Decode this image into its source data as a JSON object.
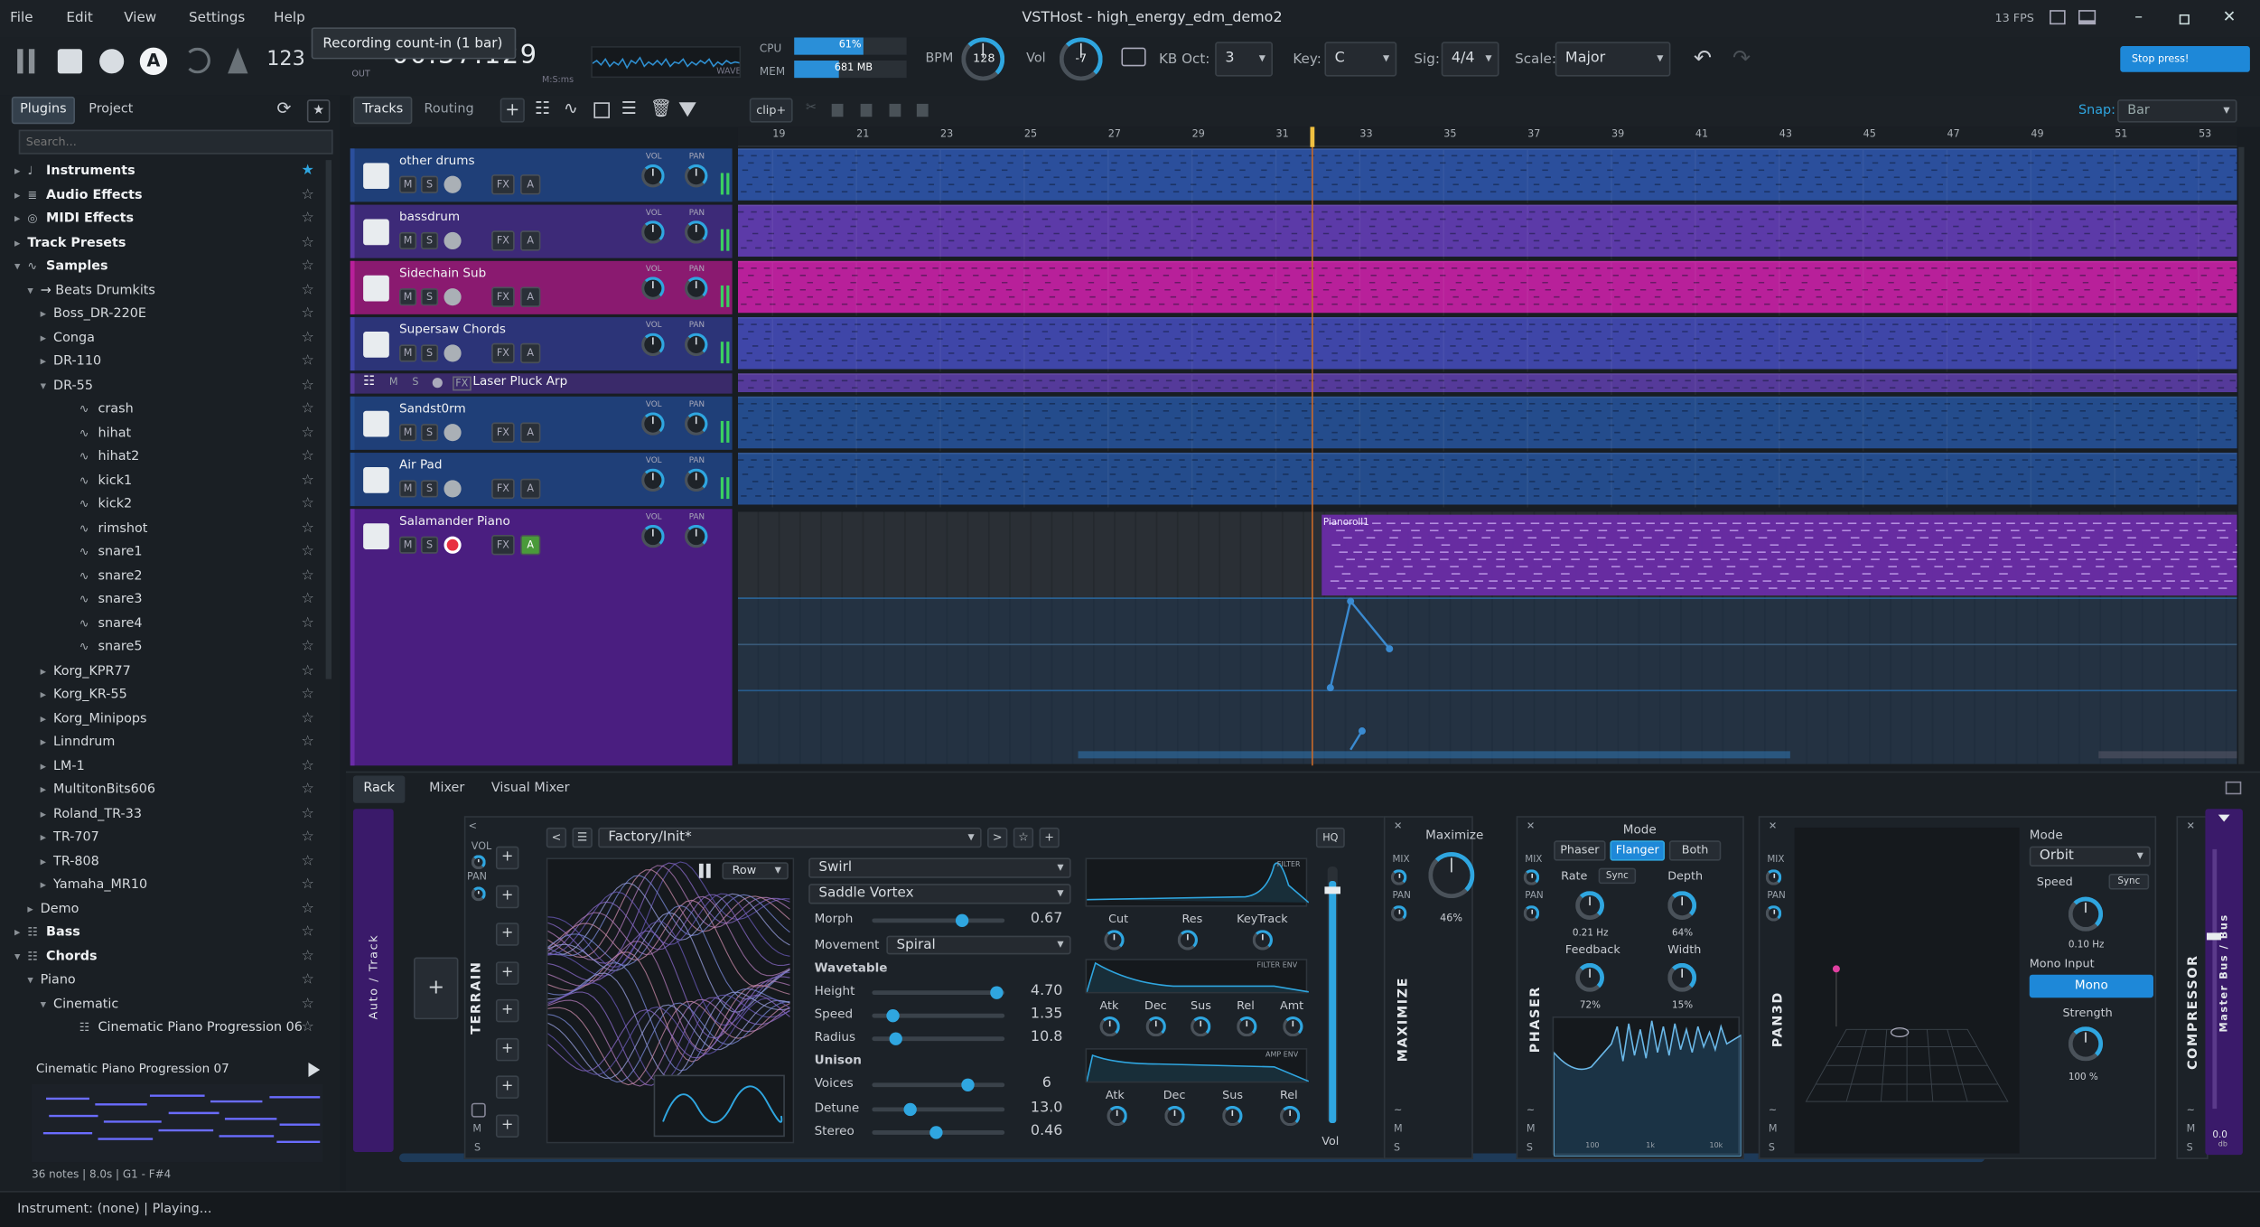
{
  "app": {
    "title": "VSTHost - high_energy_edm_demo2",
    "fps": "13 FPS"
  },
  "menu": [
    "File",
    "Edit",
    "View",
    "Settings",
    "Help"
  ],
  "transport": {
    "tooltip": "Recording count-in (1 bar)",
    "counter": "123",
    "time": "00:37:129",
    "time_unit": "M:S:ms",
    "out_label": "OUT",
    "wave_label": "WAVE",
    "cpu_label": "CPU",
    "cpu_value": "61%",
    "cpu_fraction": 0.61,
    "mem_label": "MEM",
    "mem_value": "681 MB",
    "mem_fraction": 0.4,
    "bpm_label": "BPM",
    "bpm": "128",
    "vol_label": "Vol",
    "vol": "-7",
    "kb_oct_label": "KB Oct:",
    "kb_oct": "3",
    "key_label": "Key:",
    "key": "C",
    "sig_label": "Sig:",
    "sig": "4/4",
    "scale_label": "Scale:",
    "scale": "Major",
    "stop_label": "Stop press!"
  },
  "left_tabs": [
    "Plugins",
    "Project"
  ],
  "search_placeholder": "Search...",
  "tree": [
    {
      "label": "Instruments",
      "bold": true,
      "depth": 0,
      "arrow": "right",
      "icon": "instrument-icon",
      "starred": true
    },
    {
      "label": "Audio Effects",
      "bold": true,
      "depth": 0,
      "arrow": "right",
      "icon": "fx-icon"
    },
    {
      "label": "MIDI Effects",
      "bold": true,
      "depth": 0,
      "arrow": "right",
      "icon": "midi-icon"
    },
    {
      "label": "Track Presets",
      "bold": true,
      "depth": 0,
      "arrow": "right"
    },
    {
      "label": "Samples",
      "bold": true,
      "depth": 0,
      "arrow": "down",
      "icon": "wave-icon"
    },
    {
      "label": "→ Beats Drumkits",
      "depth": 1,
      "arrow": "down"
    },
    {
      "label": "Boss_DR-220E",
      "depth": 2,
      "arrow": "right"
    },
    {
      "label": "Conga",
      "depth": 2,
      "arrow": "right"
    },
    {
      "label": "DR-110",
      "depth": 2,
      "arrow": "right"
    },
    {
      "label": "DR-55",
      "depth": 2,
      "arrow": "down"
    },
    {
      "label": "crash",
      "depth": 3,
      "icon": "wave-icon"
    },
    {
      "label": "hihat",
      "depth": 3,
      "icon": "wave-icon"
    },
    {
      "label": "hihat2",
      "depth": 3,
      "icon": "wave-icon"
    },
    {
      "label": "kick1",
      "depth": 3,
      "icon": "wave-icon"
    },
    {
      "label": "kick2",
      "depth": 3,
      "icon": "wave-icon"
    },
    {
      "label": "rimshot",
      "depth": 3,
      "icon": "wave-icon"
    },
    {
      "label": "snare1",
      "depth": 3,
      "icon": "wave-icon"
    },
    {
      "label": "snare2",
      "depth": 3,
      "icon": "wave-icon"
    },
    {
      "label": "snare3",
      "depth": 3,
      "icon": "wave-icon"
    },
    {
      "label": "snare4",
      "depth": 3,
      "icon": "wave-icon"
    },
    {
      "label": "snare5",
      "depth": 3,
      "icon": "wave-icon"
    },
    {
      "label": "Korg_KPR77",
      "depth": 2,
      "arrow": "right"
    },
    {
      "label": "Korg_KR-55",
      "depth": 2,
      "arrow": "right"
    },
    {
      "label": "Korg_Minipops",
      "depth": 2,
      "arrow": "right"
    },
    {
      "label": "Linndrum",
      "depth": 2,
      "arrow": "right"
    },
    {
      "label": "LM-1",
      "depth": 2,
      "arrow": "right"
    },
    {
      "label": "MultitonBits606",
      "depth": 2,
      "arrow": "right"
    },
    {
      "label": "Roland_TR-33",
      "depth": 2,
      "arrow": "right"
    },
    {
      "label": "TR-707",
      "depth": 2,
      "arrow": "right"
    },
    {
      "label": "TR-808",
      "depth": 2,
      "arrow": "right"
    },
    {
      "label": "Yamaha_MR10",
      "depth": 2,
      "arrow": "right"
    },
    {
      "label": "Demo",
      "depth": 1,
      "arrow": "right"
    },
    {
      "label": "Bass",
      "bold": true,
      "depth": 0,
      "arrow": "right",
      "icon": "piano-icon"
    },
    {
      "label": "Chords",
      "bold": true,
      "depth": 0,
      "arrow": "down",
      "icon": "piano-icon"
    },
    {
      "label": "Piano",
      "depth": 1,
      "arrow": "down"
    },
    {
      "label": "Cinematic",
      "depth": 2,
      "arrow": "down"
    },
    {
      "label": "Cinematic Piano Progression 06",
      "depth": 3,
      "icon": "piano-icon"
    }
  ],
  "preview": {
    "title": "Cinematic Piano Progression 07",
    "info": "36 notes | 8.0s | G1 - F#4"
  },
  "status": "Instrument: (none)  |  Playing...",
  "arrange": {
    "tabs": [
      "Tracks",
      "Routing"
    ],
    "clip_label": "clip+",
    "snap_label": "Snap:",
    "snap": "Bar",
    "bars": [
      "19",
      "21",
      "23",
      "25",
      "27",
      "29",
      "31",
      "33",
      "35",
      "37",
      "39",
      "41",
      "43",
      "45",
      "47",
      "49",
      "51",
      "53"
    ],
    "playhead_bar": 32.5
  },
  "tracks": [
    {
      "name": "other drums",
      "color": "#1f3f78",
      "lane": "#2b4f9c"
    },
    {
      "name": "bassdrum",
      "color": "#3d2a78",
      "lane": "#5c3aa8"
    },
    {
      "name": "Sidechain Sub",
      "color": "#8a1a70",
      "lane": "#b8209a"
    },
    {
      "name": "Supersaw Chords",
      "color": "#2c3478",
      "lane": "#3f46a8"
    },
    {
      "name": "Laser Pluck Arp",
      "color": "#3a2a6a",
      "lane": "#553a9a"
    },
    {
      "name": "Sandst0rm",
      "color": "#1f3f78",
      "lane": "#244c8c"
    },
    {
      "name": "Air Pad",
      "color": "#1f3f78",
      "lane": "#244c8c"
    },
    {
      "name": "Salamander Piano",
      "color": "#4a1e80",
      "lane": "#6a2ca8"
    }
  ],
  "track_labels": {
    "mute": "M",
    "solo": "S",
    "fx": "FX",
    "auto": "A",
    "vol": "VOL",
    "pan": "PAN"
  },
  "pianoroll_clip": "Pianoroll1",
  "rack": {
    "tabs": [
      "Rack",
      "Mixer",
      "Visual Mixer"
    ],
    "side_label": "Auto / Track",
    "add": "+",
    "terrain": {
      "name": "TERRAIN",
      "preset": "Factory/Init*",
      "hq": "HQ",
      "row_mode": "Row",
      "shape1": "Swirl",
      "shape2": "Saddle Vortex",
      "morph_label": "Morph",
      "morph": "0.67",
      "movement_label": "Movement",
      "movement": "Spiral",
      "wavetable": "Wavetable",
      "height_label": "Height",
      "height": "4.70",
      "speed_label": "Speed",
      "speed": "1.35",
      "radius_label": "Radius",
      "radius": "10.8",
      "unison": "Unison",
      "voices_label": "Voices",
      "voices": "6",
      "detune_label": "Detune",
      "detune": "13.0",
      "stereo_label": "Stereo",
      "stereo": "0.46",
      "filter_tag": "FILTER",
      "cut": "Cut",
      "res": "Res",
      "keytrack": "KeyTrack",
      "filter_env": "FILTER ENV",
      "atk": "Atk",
      "dec": "Dec",
      "sus": "Sus",
      "rel": "Rel",
      "amt": "Amt",
      "amp_env": "AMP ENV",
      "vol": "Vol",
      "mix": "MIX",
      "pan": "PAN"
    },
    "maximize": {
      "name": "MAXIMIZE",
      "label": "Maximize",
      "value": "46%"
    },
    "phaser": {
      "name": "PHASER",
      "mode_label": "Mode",
      "modes": [
        "Phaser",
        "Flanger",
        "Both"
      ],
      "active": "Flanger",
      "rate_label": "Rate",
      "sync": "Sync",
      "rate": "0.21 Hz",
      "depth_label": "Depth",
      "depth": "64%",
      "feedback_label": "Feedback",
      "feedback": "72%",
      "width_label": "Width",
      "width": "15%",
      "freqs": [
        "100",
        "1k",
        "10k"
      ]
    },
    "pan3d": {
      "name": "PAN3D",
      "mode_label": "Mode",
      "mode": "Orbit",
      "speed_label": "Speed",
      "sync": "Sync",
      "speed": "0.10 Hz",
      "mono_input_label": "Mono Input",
      "mono": "Mono",
      "strength_label": "Strength",
      "strength": "100 %"
    },
    "compressor": {
      "name": "COMPRESSOR"
    },
    "master": {
      "name": "Master Bus / Bus",
      "value": "0.0",
      "unit": "db"
    }
  }
}
